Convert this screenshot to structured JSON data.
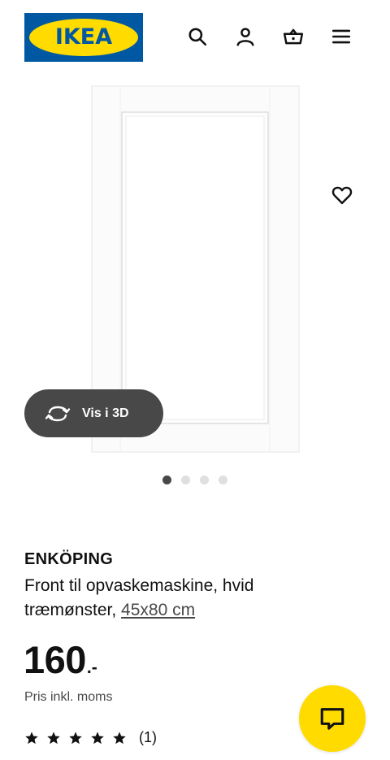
{
  "header": {
    "logo_text": "IKEA",
    "icons": [
      "search-icon",
      "user-icon",
      "basket-icon",
      "menu-icon"
    ],
    "brand_blue": "#0058a3",
    "brand_yellow": "#ffdb00"
  },
  "gallery": {
    "view_3d_label": "Vis i 3D",
    "image_count": 4,
    "active_image": 1
  },
  "product": {
    "name": "ENKÖPING",
    "description": "Front til opvaskemaskine, hvid træmønster,",
    "size_link": "45x80 cm",
    "price_integer": "160",
    "price_suffix": ".-",
    "price_note": "Pris inkl. moms",
    "rating_stars": 5,
    "rating_count": "(1)"
  },
  "chat": {
    "icon": "chat-icon",
    "color": "#ffdb00"
  }
}
